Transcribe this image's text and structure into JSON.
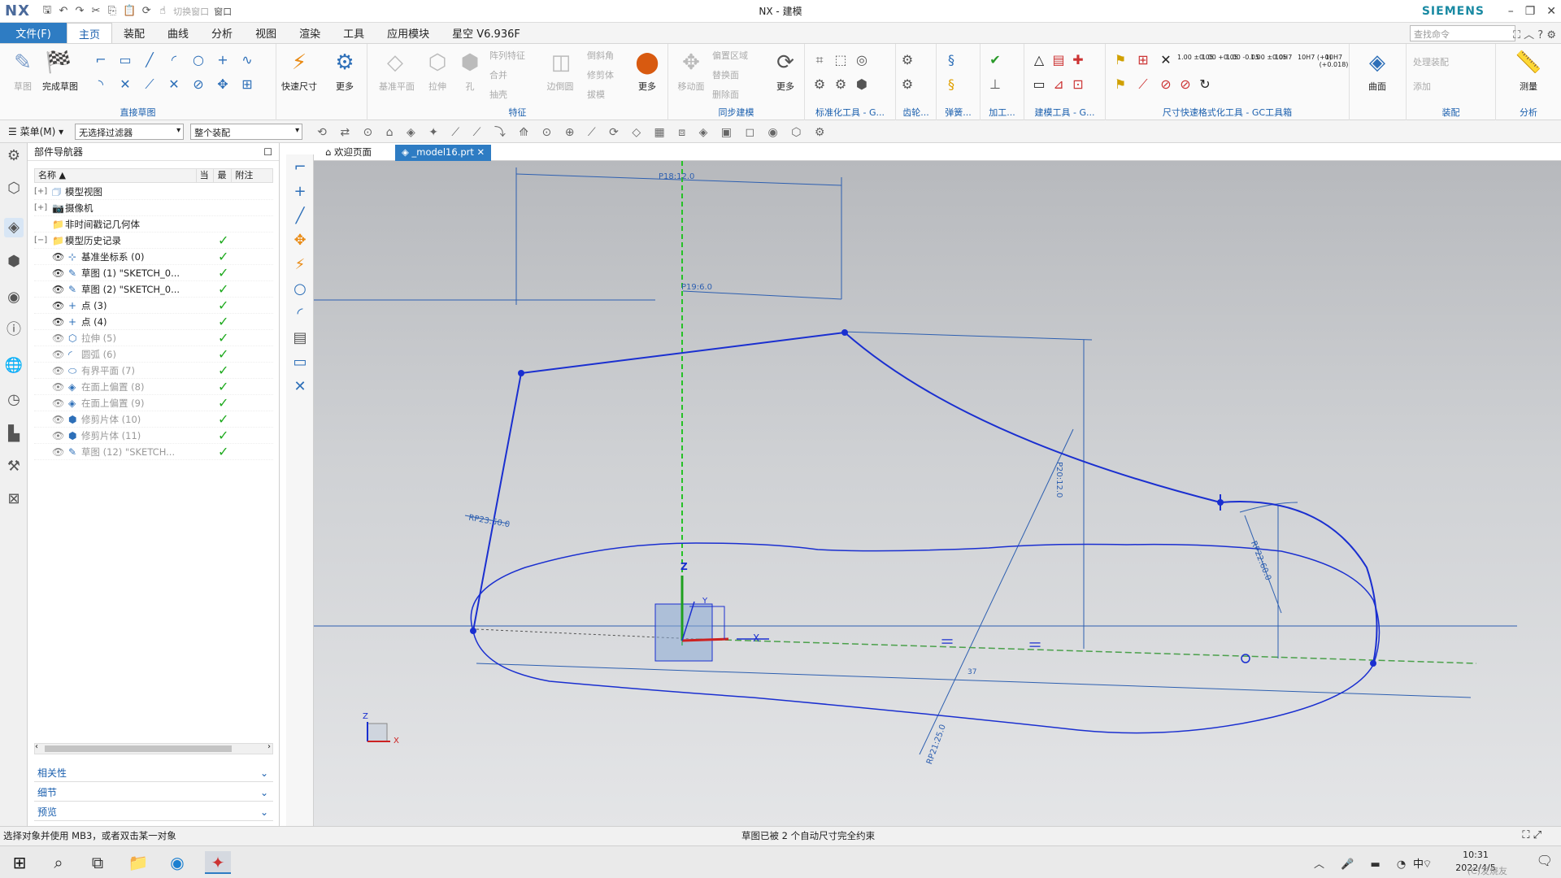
{
  "app": {
    "logo": "NX",
    "window_title": "NX - 建模",
    "brand": "SIEMENS",
    "switch_window": "切换窗口",
    "window_menu": "窗口"
  },
  "ribbon_tabs": {
    "file": "文件(F)",
    "tabs": [
      "主页",
      "装配",
      "曲线",
      "分析",
      "视图",
      "渲染",
      "工具",
      "应用模块",
      "星空 V6.936F"
    ],
    "active_index": 0,
    "search_placeholder": "查找命令"
  },
  "ribbon": {
    "direct_sketch": {
      "label": "直接草图",
      "sketch": "草图",
      "finish": "完成草图"
    },
    "quick_dim": {
      "label": "快速尺寸",
      "more": "更多"
    },
    "feature": {
      "label": "特征",
      "datum_plane": "基准平面",
      "extrude": "拉伸",
      "hole": "孔",
      "pattern": "阵列特征",
      "unite": "合并",
      "shell": "抽壳",
      "edge_blend": "边倒圆",
      "chamfer": "倒斜角",
      "trim_body": "修剪体",
      "draft": "拔模",
      "more": "更多"
    },
    "sync": {
      "label": "同步建模",
      "move_face": "移动面",
      "offset_region": "偏置区域",
      "replace_face": "替换面",
      "delete_face": "删除面",
      "more": "更多"
    },
    "groups": [
      "标准化工具 - G...",
      "齿轮...",
      "弹簧...",
      "加工...",
      "建模工具 - G...",
      "尺寸快速格式化工具 - GC工具箱",
      "装配",
      "分析"
    ],
    "surface": "曲面",
    "measure": "测量",
    "assembly_ops": [
      "处理装配",
      "添加"
    ],
    "dim_formats": [
      "1.00\n±0.05",
      "1.00\n+0.05",
      "1.00\n-0.05",
      "1.00\n±0.05",
      "10H7",
      "10H7\n(+0)",
      "10H7\n(+0.018)",
      "10\n(H7)"
    ]
  },
  "command_bar": {
    "menu": "菜单(M)",
    "filter": "无选择过滤器",
    "scope": "整个装配"
  },
  "navigator": {
    "title": "部件导航器",
    "columns": [
      "名称",
      "当",
      "最",
      "附注"
    ],
    "nodes": [
      {
        "text": "模型视图",
        "level": 0,
        "toggle": "+",
        "check": false,
        "dim": false
      },
      {
        "text": "摄像机",
        "level": 0,
        "toggle": "+",
        "check": false,
        "dim": false
      },
      {
        "text": "非时间戳记几何体",
        "level": 0,
        "toggle": "",
        "check": false,
        "dim": false
      },
      {
        "text": "模型历史记录",
        "level": 0,
        "toggle": "−",
        "check": true,
        "dim": false
      },
      {
        "text": "基准坐标系 (0)",
        "level": 1,
        "check": true,
        "dim": false
      },
      {
        "text": "草图 (1) \"SKETCH_0...",
        "level": 1,
        "check": true,
        "dim": false
      },
      {
        "text": "草图 (2) \"SKETCH_0...",
        "level": 1,
        "check": true,
        "dim": false
      },
      {
        "text": "点 (3)",
        "level": 1,
        "check": true,
        "dim": false
      },
      {
        "text": "点 (4)",
        "level": 1,
        "check": true,
        "dim": false
      },
      {
        "text": "拉伸 (5)",
        "level": 1,
        "check": true,
        "dim": true
      },
      {
        "text": "圆弧 (6)",
        "level": 1,
        "check": true,
        "dim": true
      },
      {
        "text": "有界平面 (7)",
        "level": 1,
        "check": true,
        "dim": true
      },
      {
        "text": "在面上偏置 (8)",
        "level": 1,
        "check": true,
        "dim": true
      },
      {
        "text": "在面上偏置 (9)",
        "level": 1,
        "check": true,
        "dim": true
      },
      {
        "text": "修剪片体 (10)",
        "level": 1,
        "check": true,
        "dim": true
      },
      {
        "text": "修剪片体 (11)",
        "level": 1,
        "check": true,
        "dim": true
      },
      {
        "text": "草图 (12) \"SKETCH...",
        "level": 1,
        "check": true,
        "dim": true
      }
    ],
    "sections": [
      "相关性",
      "细节",
      "预览"
    ]
  },
  "doc_tabs": [
    {
      "label": "欢迎页面",
      "active": false
    },
    {
      "label": "_model16.prt",
      "active": true
    }
  ],
  "viewport": {
    "dimensions": {
      "d1": "P18:12.0",
      "d2": "P19:6.0",
      "d3": "RP23:50.0",
      "d4": "P20:12.0",
      "d5": "RP22:60.0",
      "d6": "RP21:25.0",
      "d7": "37"
    },
    "axes": {
      "x": "X",
      "y": "Y",
      "z": "Z"
    }
  },
  "status": {
    "left": "选择对象并使用 MB3，或者双击某一对象",
    "center": "草图已被 2 个自动尺寸完全约束"
  },
  "taskbar": {
    "time": "10:31",
    "date": "2022/4/5",
    "ime": "中",
    "watermark": "(C)发烧友"
  },
  "colors": {
    "accent": "#2e7cc3",
    "sketch_curve": "#1a2fd0",
    "dimension": "#2d5fb0",
    "green_axis": "#26c226",
    "check": "#1faa1f"
  }
}
